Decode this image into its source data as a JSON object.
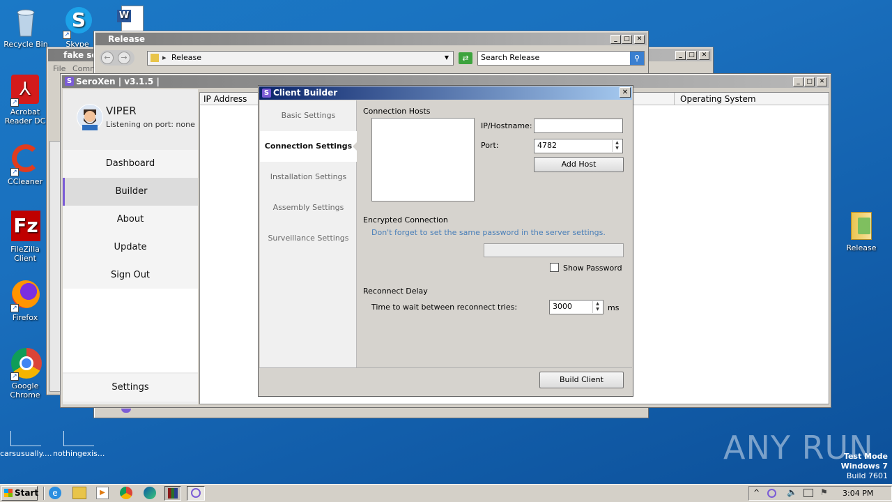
{
  "desktop": {
    "icons_left": [
      {
        "id": "recycle",
        "label": "Recycle Bin"
      },
      {
        "id": "skype",
        "label": "Skype"
      },
      {
        "id": "acrobat",
        "label": "Acrobat Reader DC"
      },
      {
        "id": "ccleaner",
        "label": "CCleaner"
      },
      {
        "id": "filezilla",
        "label": "FileZilla Client"
      },
      {
        "id": "firefox",
        "label": "Firefox"
      },
      {
        "id": "chrome",
        "label": "Google Chrome"
      }
    ],
    "icon_release": "Release",
    "file1": "carsusually....",
    "file2": "nothingexis...",
    "watermark": "ANY RUN",
    "testmode": [
      "Test Mode",
      "Windows 7",
      "Build 7601"
    ]
  },
  "explorer": {
    "title": "Release",
    "address": "Release",
    "search_placeholder": "Search Release"
  },
  "fakewin": {
    "title": "fake ser",
    "menu_file": "File",
    "menu_comm": "Comm"
  },
  "seroxen": {
    "title": "SeroXen | v3.1.5 |",
    "username": "VIPER",
    "status": "Listening on port: none",
    "nav": [
      "Dashboard",
      "Builder",
      "About",
      "Update",
      "Sign Out"
    ],
    "settings": "Settings",
    "col_ip": "IP Address",
    "col_os": "Operating System"
  },
  "builder": {
    "title": "Client Builder",
    "tabs": [
      "Basic Settings",
      "Connection Settings",
      "Installation Settings",
      "Assembly Settings",
      "Surveillance Settings"
    ],
    "hosts_label": "Connection Hosts",
    "ip_label": "IP/Hostname:",
    "ip_value": "",
    "port_label": "Port:",
    "port_value": "4782",
    "add_host": "Add Host",
    "enc_label": "Encrypted Connection",
    "enc_hint": "Don't forget to set the same password in the server settings.",
    "show_password": "Show Password",
    "reconnect_label": "Reconnect Delay",
    "reconnect_text": "Time to wait between reconnect tries:",
    "reconnect_value": "3000",
    "ms": "ms",
    "build_client": "Build Client"
  },
  "taskbar": {
    "start": "Start",
    "time": "3:04 PM"
  },
  "colors": {
    "accent": "#7b5cd6",
    "desktop": "#1a6fbd",
    "titlebar_active": "#0a246a"
  }
}
